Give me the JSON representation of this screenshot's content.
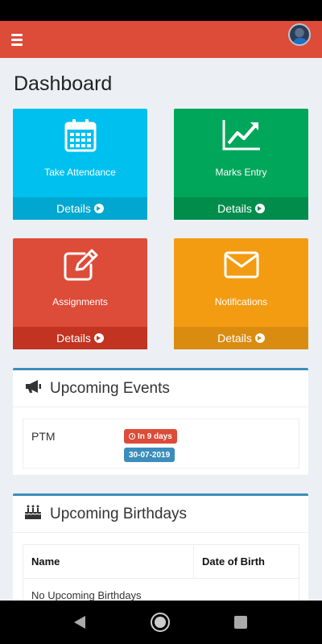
{
  "page_title": "Dashboard",
  "tiles": [
    {
      "label": "Take Attendance",
      "footer": "Details",
      "icon": "calendar-icon",
      "color": "#00c0ef"
    },
    {
      "label": "Marks Entry",
      "footer": "Details",
      "icon": "line-chart-icon",
      "color": "#00a65a"
    },
    {
      "label": "Assignments",
      "footer": "Details",
      "icon": "edit-icon",
      "color": "#dd4b39"
    },
    {
      "label": "Notifications",
      "footer": "Details",
      "icon": "envelope-icon",
      "color": "#f39c12"
    }
  ],
  "events": {
    "title": "Upcoming Events",
    "icon": "bullhorn-icon",
    "items": [
      {
        "name": "PTM",
        "countdown": "In 9 days",
        "date": "30-07-2019"
      }
    ]
  },
  "birthdays": {
    "title": "Upcoming Birthdays",
    "icon": "birthday-cake-icon",
    "columns": [
      "Name",
      "Date of Birth"
    ],
    "empty_message": "No Upcoming Birthdays"
  },
  "colors": {
    "header": "#dd4b39",
    "box_border": "#3c8dbc"
  }
}
